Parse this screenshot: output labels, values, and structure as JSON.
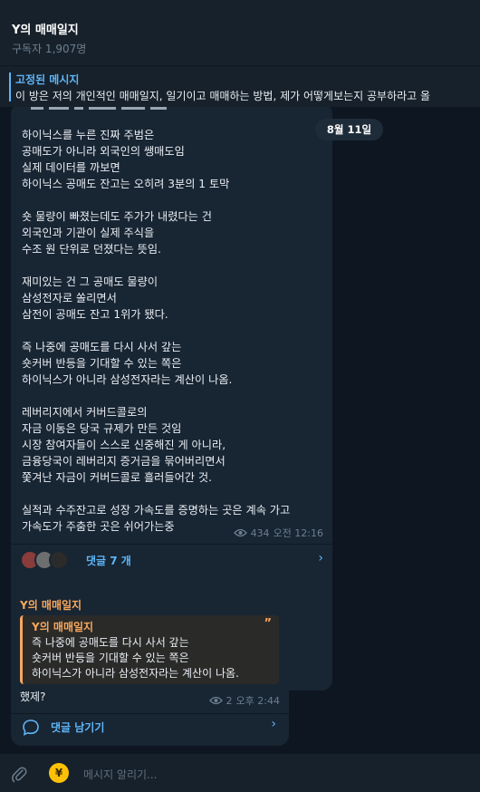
{
  "header": {
    "title": "Y의 매매일지",
    "subscribers": "구독자 1,907명"
  },
  "pinned": {
    "title": "고정된 메시지",
    "text": "이 방은 저의 개인적인 매매일지, 일기이고 매매하는 방법, 제가 어떻게보는지 공부하라고 올"
  },
  "date_chip": "8월 11일",
  "post": {
    "body": "하이닉스를 누른 진짜 주범은\n공매도가 아니라 외국인의 쌩매도임\n실제 데이터를 까보면\n하이닉스 공매도 잔고는 오히려 3분의 1 토막\n\n숏 물량이 빠졌는데도 주가가 내렸다는 건\n외국인과 기관이 실제 주식을\n수조 원 단위로 던졌다는 뜻임.\n\n재미있는 건 그 공매도 물량이\n삼성전자로 쏠리면서\n삼전이 공매도 잔고 1위가 됐다.\n\n즉 나중에 공매도를 다시 사서 갚는\n숏커버 반등을 기대할 수 있는 쪽은\n하이닉스가 아니라 삼성전자라는 계산이 나옴.\n\n레버리지에서 커버드콜로의\n자금 이동은 당국 규제가 만든 것임\n시장 참여자들이 스스로 신중해진 게 아니라,\n금융당국이 레버리지 증거금을 묶어버리면서\n쫓겨난 자금이 커버드콜로 흘러들어간 것.\n\n실적과 수주잔고로 성장 가속도를 증명하는 곳은 계속 가고\n가속도가 주춤한 곳은 쉬어가는중",
    "views": "434",
    "time": "오전 12:16",
    "comments": "댓글 7 개"
  },
  "reply_msg": {
    "sender": "Y의 매매일지",
    "quote_name": "Y의 매매일지",
    "quote_text": "즉 나중에 공매도를 다시 사서 갚는\n숏커버 반등을 기대할 수 있는 쪽은\n하이닉스가 아니라 삼성전자라는 계산이 나옴.",
    "text": "했제?",
    "views": "2",
    "time": "오후 2:44",
    "comment_label": "댓글 남기기"
  },
  "composer": {
    "placeholder": "메시지 알리기..."
  },
  "colors": {
    "background": "#0e1621",
    "panel": "#17212b",
    "bubble": "#182533",
    "accent": "#5eb5f7",
    "sender": "#f6a75c"
  }
}
